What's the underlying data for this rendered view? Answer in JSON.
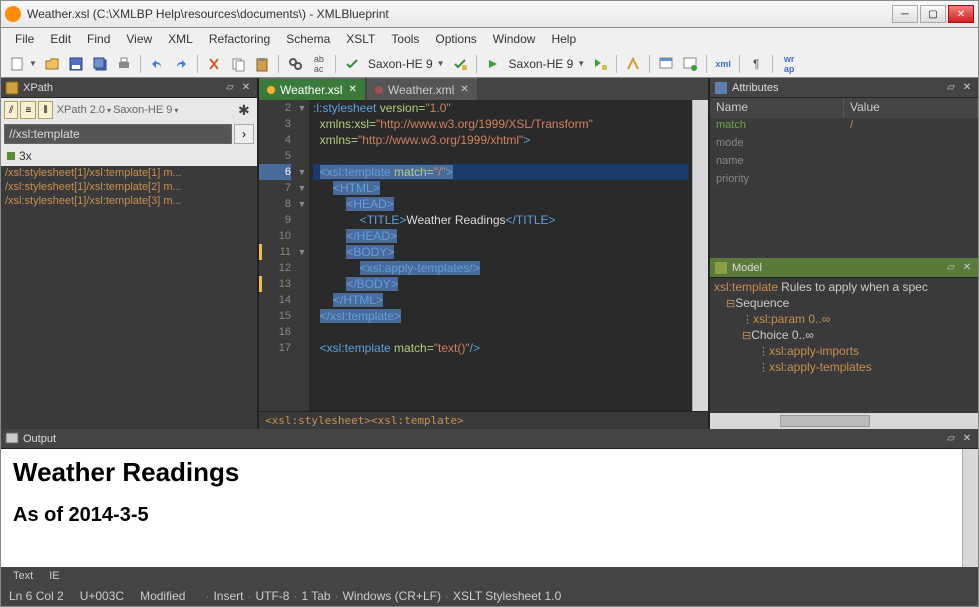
{
  "titlebar": {
    "text": "Weather.xsl  (C:\\XMLBP Help\\resources\\documents\\) - XMLBlueprint"
  },
  "menu": [
    "File",
    "Edit",
    "Find",
    "View",
    "XML",
    "Refactoring",
    "Schema",
    "XSLT",
    "Tools",
    "Options",
    "Window",
    "Help"
  ],
  "toolbar": {
    "saxon1": "Saxon-HE 9",
    "saxon2": "Saxon-HE 9"
  },
  "xpath": {
    "title": "XPath",
    "version": "XPath 2.0",
    "engine": "Saxon-HE 9",
    "input": "//xsl:template",
    "count": "3x",
    "results": [
      "/xsl:stylesheet[1]/xsl:template[1] m...",
      "/xsl:stylesheet[1]/xsl:template[2] m...",
      "/xsl:stylesheet[1]/xsl:template[3] m..."
    ]
  },
  "tabs": [
    {
      "label": "Weather.xsl",
      "active": true
    },
    {
      "label": "Weather.xml",
      "active": false
    }
  ],
  "editor": {
    "lines": [
      2,
      3,
      4,
      5,
      6,
      7,
      8,
      9,
      10,
      11,
      12,
      13,
      14,
      15,
      16,
      17
    ],
    "currentLine": 6,
    "breadcrumb": "<xsl:stylesheet><xsl:template>"
  },
  "code": {
    "l2": ":l:stylesheet",
    "l2v": "version=",
    "l2s": "\"1.0\"",
    "l3": "  xmlns:xsl=",
    "l3s": "\"http://www.w3.org/1999/XSL/Transform\"",
    "l4": "  xmlns=",
    "l4s": "\"http://www.w3.org/1999/xhtml\"",
    "l4e": ">",
    "l6a": "<xsl:template",
    "l6b": " match=",
    "l6c": "\"/\"",
    "l6d": ">",
    "l7": "<HTML>",
    "l8": "<HEAD>",
    "l9a": "<TITLE>",
    "l9b": "Weather Readings",
    "l9c": "</TITLE>",
    "l10": "</HEAD>",
    "l11": "<BODY>",
    "l12": "<xsl:apply-templates/>",
    "l13": "</BODY>",
    "l14": "</HTML>",
    "l15": "</xsl:template>",
    "l17a": "<xsl:template",
    "l17b": " match=",
    "l17c": "\"text()\"",
    "l17d": "/>"
  },
  "attributes": {
    "title": "Attributes",
    "cols": [
      "Name",
      "Value"
    ],
    "rows": [
      {
        "name": "match",
        "value": "/",
        "active": true
      },
      {
        "name": "mode",
        "value": ""
      },
      {
        "name": "name",
        "value": ""
      },
      {
        "name": "priority",
        "value": ""
      }
    ]
  },
  "model": {
    "title": "Model",
    "root": "xsl:template",
    "desc": "Rules to apply when a spec",
    "tree": [
      "Sequence",
      "xsl:param 0..∞",
      "Choice 0..∞",
      "xsl:apply-imports",
      "xsl:apply-templates"
    ]
  },
  "output": {
    "title": "Output",
    "h1": "Weather Readings",
    "h2": "As of 2014-3-5",
    "tabs": [
      "Text",
      "IE"
    ]
  },
  "status": {
    "pos": "Ln 6  Col 2",
    "code": "U+003C",
    "items": [
      "Modified",
      "Insert",
      "UTF-8",
      "1 Tab",
      "Windows (CR+LF)",
      "XSLT Stylesheet 1.0"
    ]
  }
}
